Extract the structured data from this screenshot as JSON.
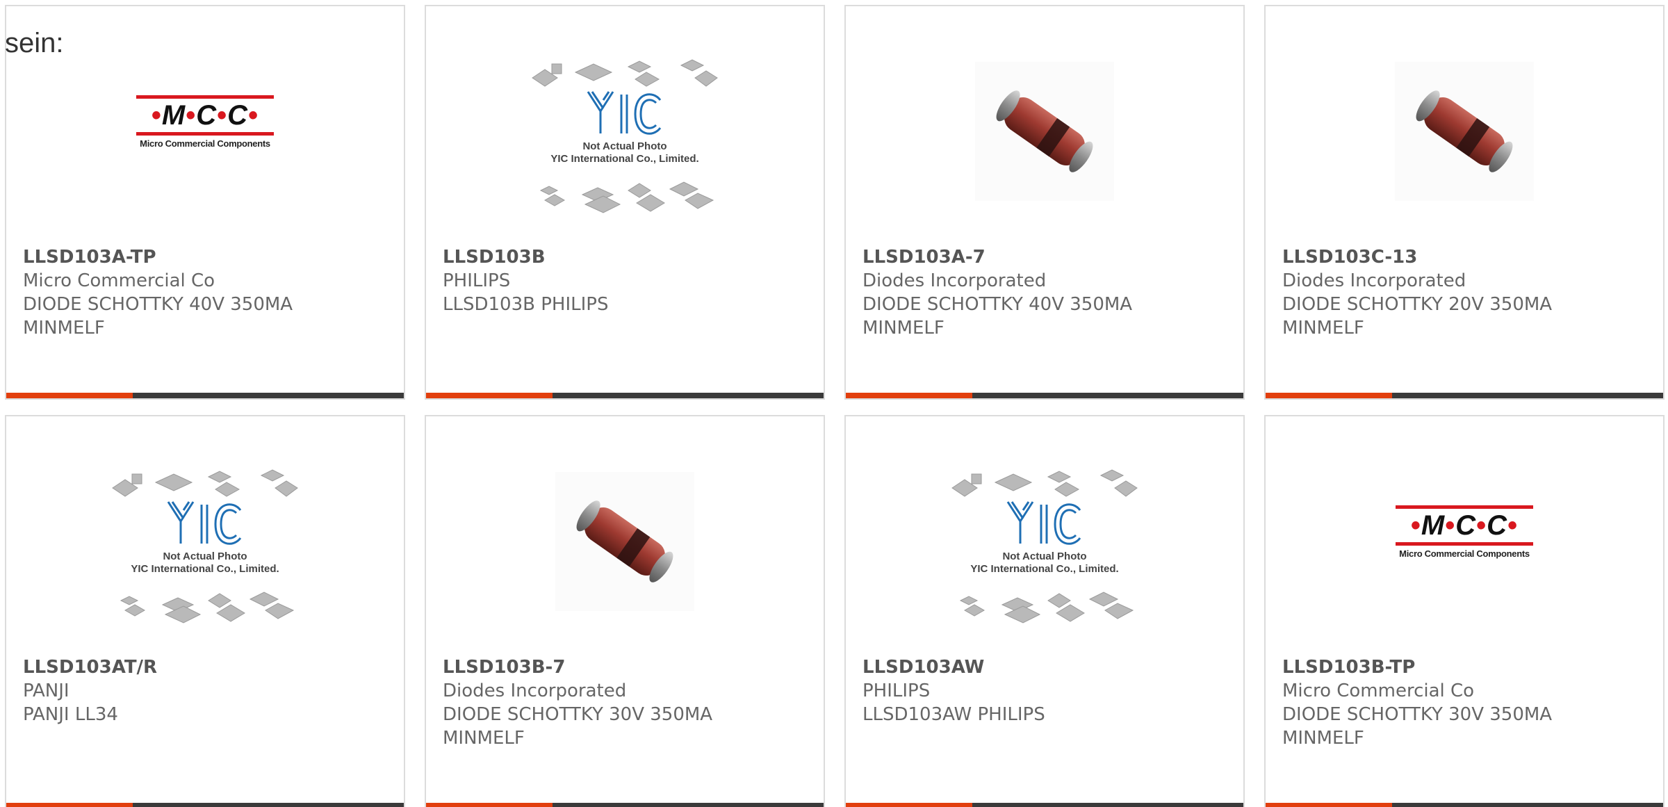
{
  "intro": "sein:",
  "colors": {
    "accent": "#e23f0e",
    "bar": "#3a3a3a",
    "mcc_red": "#d9181f",
    "yic_blue": "#1f6fb4"
  },
  "products": [
    {
      "part": "LLSD103A-TP",
      "manufacturer": "Micro Commercial Co",
      "description": "DIODE SCHOTTKY 40V 350MA",
      "description2": "MINMELF",
      "image": "mcc-logo"
    },
    {
      "part": "LLSD103B",
      "manufacturer": "PHILIPS",
      "description": "LLSD103B PHILIPS",
      "description2": "",
      "image": "yic-placeholder"
    },
    {
      "part": "LLSD103A-7",
      "manufacturer": "Diodes Incorporated",
      "description": "DIODE SCHOTTKY 40V 350MA",
      "description2": "MINMELF",
      "image": "diode-photo"
    },
    {
      "part": "LLSD103C-13",
      "manufacturer": "Diodes Incorporated",
      "description": "DIODE SCHOTTKY 20V 350MA",
      "description2": "MINMELF",
      "image": "diode-photo"
    },
    {
      "part": "LLSD103AT/R",
      "manufacturer": "PANJI",
      "description": "PANJI LL34",
      "description2": "",
      "image": "yic-placeholder"
    },
    {
      "part": "LLSD103B-7",
      "manufacturer": "Diodes Incorporated",
      "description": "DIODE SCHOTTKY 30V 350MA",
      "description2": "MINMELF",
      "image": "diode-photo"
    },
    {
      "part": "LLSD103AW",
      "manufacturer": "PHILIPS",
      "description": "LLSD103AW PHILIPS",
      "description2": "",
      "image": "yic-placeholder"
    },
    {
      "part": "LLSD103B-TP",
      "manufacturer": "Micro Commercial Co",
      "description": "DIODE SCHOTTKY 30V 350MA",
      "description2": "MINMELF",
      "image": "mcc-logo"
    }
  ],
  "logos": {
    "mcc": {
      "mark": "M C C",
      "tagline": "Micro Commercial Components"
    },
    "yic": {
      "caption1": "Not Actual Photo",
      "caption2": "YIC International Co., Limited."
    }
  }
}
